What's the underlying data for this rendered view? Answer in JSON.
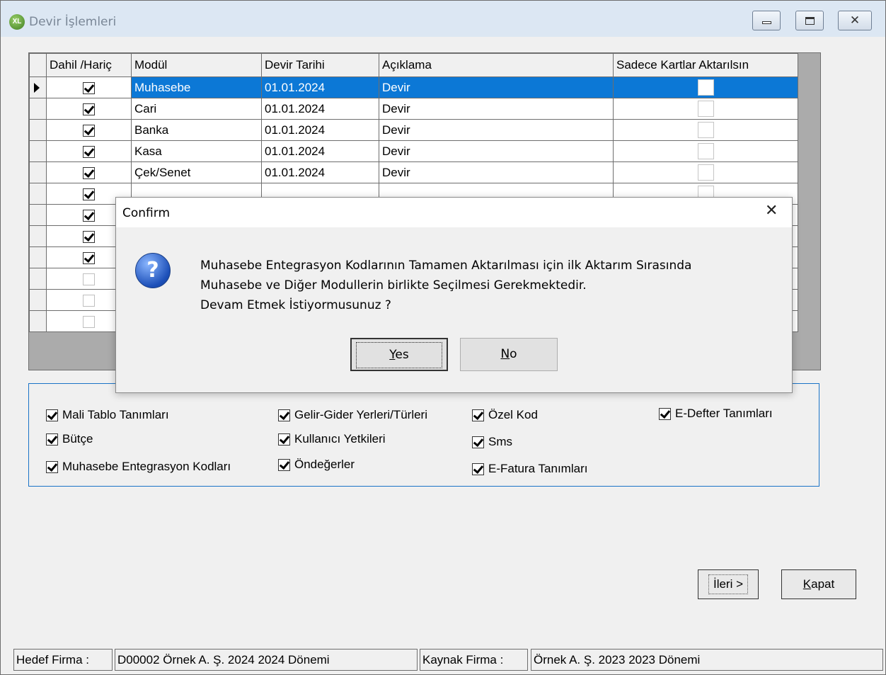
{
  "window": {
    "title": "Devir İşlemleri",
    "icon": "xl-logo-icon"
  },
  "grid": {
    "columns": [
      "Dahil /Hariç",
      "Modül",
      "Devir Tarihi",
      "Açıklama",
      "Sadece Kartlar Aktarılsın"
    ],
    "rows": [
      {
        "dahil": true,
        "modul": "Muhasebe",
        "tarih": "01.01.2024",
        "aciklama": "Devir",
        "kart": false,
        "selected": true
      },
      {
        "dahil": true,
        "modul": "Cari",
        "tarih": "01.01.2024",
        "aciklama": "Devir",
        "kart": false
      },
      {
        "dahil": true,
        "modul": "Banka",
        "tarih": "01.01.2024",
        "aciklama": "Devir",
        "kart": false
      },
      {
        "dahil": true,
        "modul": "Kasa",
        "tarih": "01.01.2024",
        "aciklama": "Devir",
        "kart": false
      },
      {
        "dahil": true,
        "modul": "Çek/Senet",
        "tarih": "01.01.2024",
        "aciklama": "Devir",
        "kart": false
      },
      {
        "dahil": true,
        "modul": "",
        "tarih": "",
        "aciklama": "",
        "kart": false
      },
      {
        "dahil": true,
        "modul": "",
        "tarih": "",
        "aciklama": "",
        "kart": false
      },
      {
        "dahil": true,
        "modul": "",
        "tarih": "",
        "aciklama": "",
        "kart": false
      },
      {
        "dahil": true,
        "modul": "",
        "tarih": "",
        "aciklama": "",
        "kart": false
      },
      {
        "dahil": false,
        "modul": "",
        "tarih": "",
        "aciklama": "",
        "kart": false
      },
      {
        "dahil": false,
        "modul": "",
        "tarih": "",
        "aciklama": "",
        "kart": false
      },
      {
        "dahil": false,
        "modul": "",
        "tarih": "",
        "aciklama": "",
        "kart": false
      }
    ]
  },
  "options": {
    "mali_tablo": "Mali Tablo Tanımları",
    "butce": "Bütçe",
    "muh_entegrasyon": "Muhasebe Entegrasyon Kodları",
    "gelir_gider": "Gelir-Gider Yerleri/Türleri",
    "kullanici": "Kullanıcı Yetkileri",
    "ondegerler": "Öndeğerler",
    "ozel_kod": "Özel Kod",
    "sms": "Sms",
    "e_fatura": "E-Fatura Tanımları",
    "e_defter": "E-Defter Tanımları"
  },
  "buttons": {
    "ileri": "İleri >",
    "kapat_first": "K",
    "kapat_rest": "apat"
  },
  "status": {
    "hedef_label": "Hedef Firma :",
    "hedef_value": "D00002 Örnek A. Ş. 2024 2024 Dönemi",
    "kaynak_label": "Kaynak Firma :",
    "kaynak_value": "Örnek A. Ş. 2023  2023 Dönemi"
  },
  "dialog": {
    "title": "Confirm",
    "close": "✕",
    "icon": "question-icon",
    "line1": "Muhasebe Entegrasyon Kodlarının Tamamen Aktarılması için ilk Aktarım Sırasında",
    "line2": "Muhasebe ve Diğer Modullerin birlikte Seçilmesi Gerekmektedir.",
    "line3": "Devam Etmek İstiyormusunuz ?",
    "yes_first": "Y",
    "yes_rest": "es",
    "no_first": "N",
    "no_rest": "o"
  }
}
